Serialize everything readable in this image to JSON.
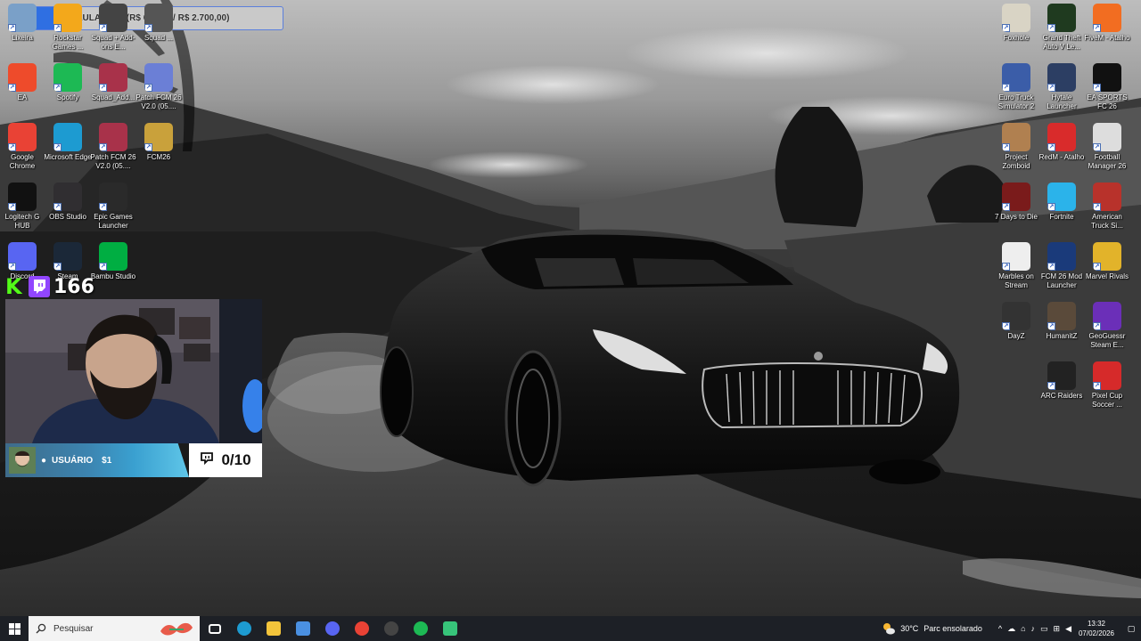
{
  "overlay": {
    "goal_text": "CELULAR IRL (R$ 673,37 / R$ 2.700,00)",
    "goal_progress": 0.2494,
    "viewer_count": "166",
    "sub_user": "USUÁRIO",
    "sub_amount": "$1",
    "sub_count": "0/10"
  },
  "desktop": {
    "left_icons": [
      {
        "label": "Lixeira",
        "icon": "recycle-bin-icon",
        "color": "#7aa0c8"
      },
      {
        "label": "Rockstar Games ...",
        "icon": "rockstar-icon",
        "color": "#f3a81b"
      },
      {
        "label": "Squad + Add-ons E...",
        "icon": "squad-icon",
        "color": "#444"
      },
      {
        "label": "Squad ...",
        "icon": "squad-icon",
        "color": "#555"
      },
      {
        "label": "EA",
        "icon": "ea-icon",
        "color": "#ee4b2b"
      },
      {
        "label": "Spotify",
        "icon": "spotify-icon",
        "color": "#1db954"
      },
      {
        "label": "Squad_Add...",
        "icon": "winrar-icon",
        "color": "#a8324a"
      },
      {
        "label": "Patch FCM 26 V2.0 (05....",
        "icon": "installer-icon",
        "color": "#6b7fd6"
      },
      {
        "label": "Google Chrome",
        "icon": "chrome-icon",
        "color": "#e94235"
      },
      {
        "label": "Microsoft Edge",
        "icon": "edge-icon",
        "color": "#1d9bd1"
      },
      {
        "label": "Patch FCM 26 V2.0 (05....",
        "icon": "winrar-icon",
        "color": "#a8324a"
      },
      {
        "label": "FCM26",
        "icon": "archive-icon",
        "color": "#c9a13b"
      },
      {
        "label": "Logitech G HUB",
        "icon": "logitech-icon",
        "color": "#111"
      },
      {
        "label": "OBS Studio",
        "icon": "obs-icon",
        "color": "#302e31"
      },
      {
        "label": "Epic Games Launcher",
        "icon": "epic-icon",
        "color": "#2a2a2a"
      },
      {
        "label": "Discord",
        "icon": "discord-icon",
        "color": "#5865f2"
      },
      {
        "label": "Steam",
        "icon": "steam-icon",
        "color": "#1b2838"
      },
      {
        "label": "Bambu Studio",
        "icon": "bambu-icon",
        "color": "#00ae42"
      }
    ],
    "right_icons": [
      {
        "label": "Foxhole",
        "icon": "foxhole-icon",
        "color": "#d9d4c5"
      },
      {
        "label": "Grand Theft Auto V Le...",
        "icon": "gta-icon",
        "color": "#1f3a1f"
      },
      {
        "label": "FiveM - Atalho",
        "icon": "fivem-icon",
        "color": "#f26d21"
      },
      {
        "label": "Euro Truck Simulator 2",
        "icon": "truck-icon",
        "color": "#3b5da8"
      },
      {
        "label": "Hytale Launcher",
        "icon": "hytale-icon",
        "color": "#2c3e63"
      },
      {
        "label": "EA SPORTS FC 26",
        "icon": "fc26-icon",
        "color": "#111"
      },
      {
        "label": "Project Zomboid",
        "icon": "zomboid-icon",
        "color": "#b08050"
      },
      {
        "label": "RedM - Atalho",
        "icon": "redm-icon",
        "color": "#d92b2b"
      },
      {
        "label": "Football Manager 26",
        "icon": "fm-icon",
        "color": "#ddd"
      },
      {
        "label": "7 Days to Die",
        "icon": "7dtd-icon",
        "color": "#7a1b1b"
      },
      {
        "label": "Fortnite",
        "icon": "fortnite-icon",
        "color": "#2bb3ea"
      },
      {
        "label": "American Truck Si...",
        "icon": "truck-icon",
        "color": "#b8322b"
      },
      {
        "label": "Marbles on Stream",
        "icon": "marbles-icon",
        "color": "#eee"
      },
      {
        "label": "FCM 26 Mod Launcher",
        "icon": "fcm-icon",
        "color": "#1a3a7a"
      },
      {
        "label": "Marvel Rivals",
        "icon": "marvel-icon",
        "color": "#e2b32a"
      },
      {
        "label": "DayZ",
        "icon": "dayz-icon",
        "color": "#333"
      },
      {
        "label": "HumanitZ",
        "icon": "humanitz-icon",
        "color": "#5a4a3a"
      },
      {
        "label": "GeoGuessr Steam E...",
        "icon": "geoguessr-icon",
        "color": "#6b2fb8"
      },
      {
        "label": "ARC Raiders",
        "icon": "arc-icon",
        "color": "#222"
      },
      {
        "label": "Pixel Cup Soccer ...",
        "icon": "pixelcup-icon",
        "color": "#d62a2a"
      }
    ]
  },
  "taskbar": {
    "search_placeholder": "Pesquisar",
    "apps": [
      {
        "icon": "task-view-icon",
        "color": "#ffffff"
      },
      {
        "icon": "edge-icon",
        "color": "#1d9bd1"
      },
      {
        "icon": "file-explorer-icon",
        "color": "#f3c43b"
      },
      {
        "icon": "store-icon",
        "color": "#4a90e2"
      },
      {
        "icon": "discord-icon",
        "color": "#5865f2"
      },
      {
        "icon": "chrome-icon",
        "color": "#e94235"
      },
      {
        "icon": "obs-icon",
        "color": "#444"
      },
      {
        "icon": "spotify-icon",
        "color": "#1db954"
      },
      {
        "icon": "app-icon",
        "color": "#37c47a"
      }
    ],
    "weather_temp": "30°C",
    "weather_text": "Parc ensolarado",
    "time": "13:32",
    "date": "07/02/2026"
  }
}
